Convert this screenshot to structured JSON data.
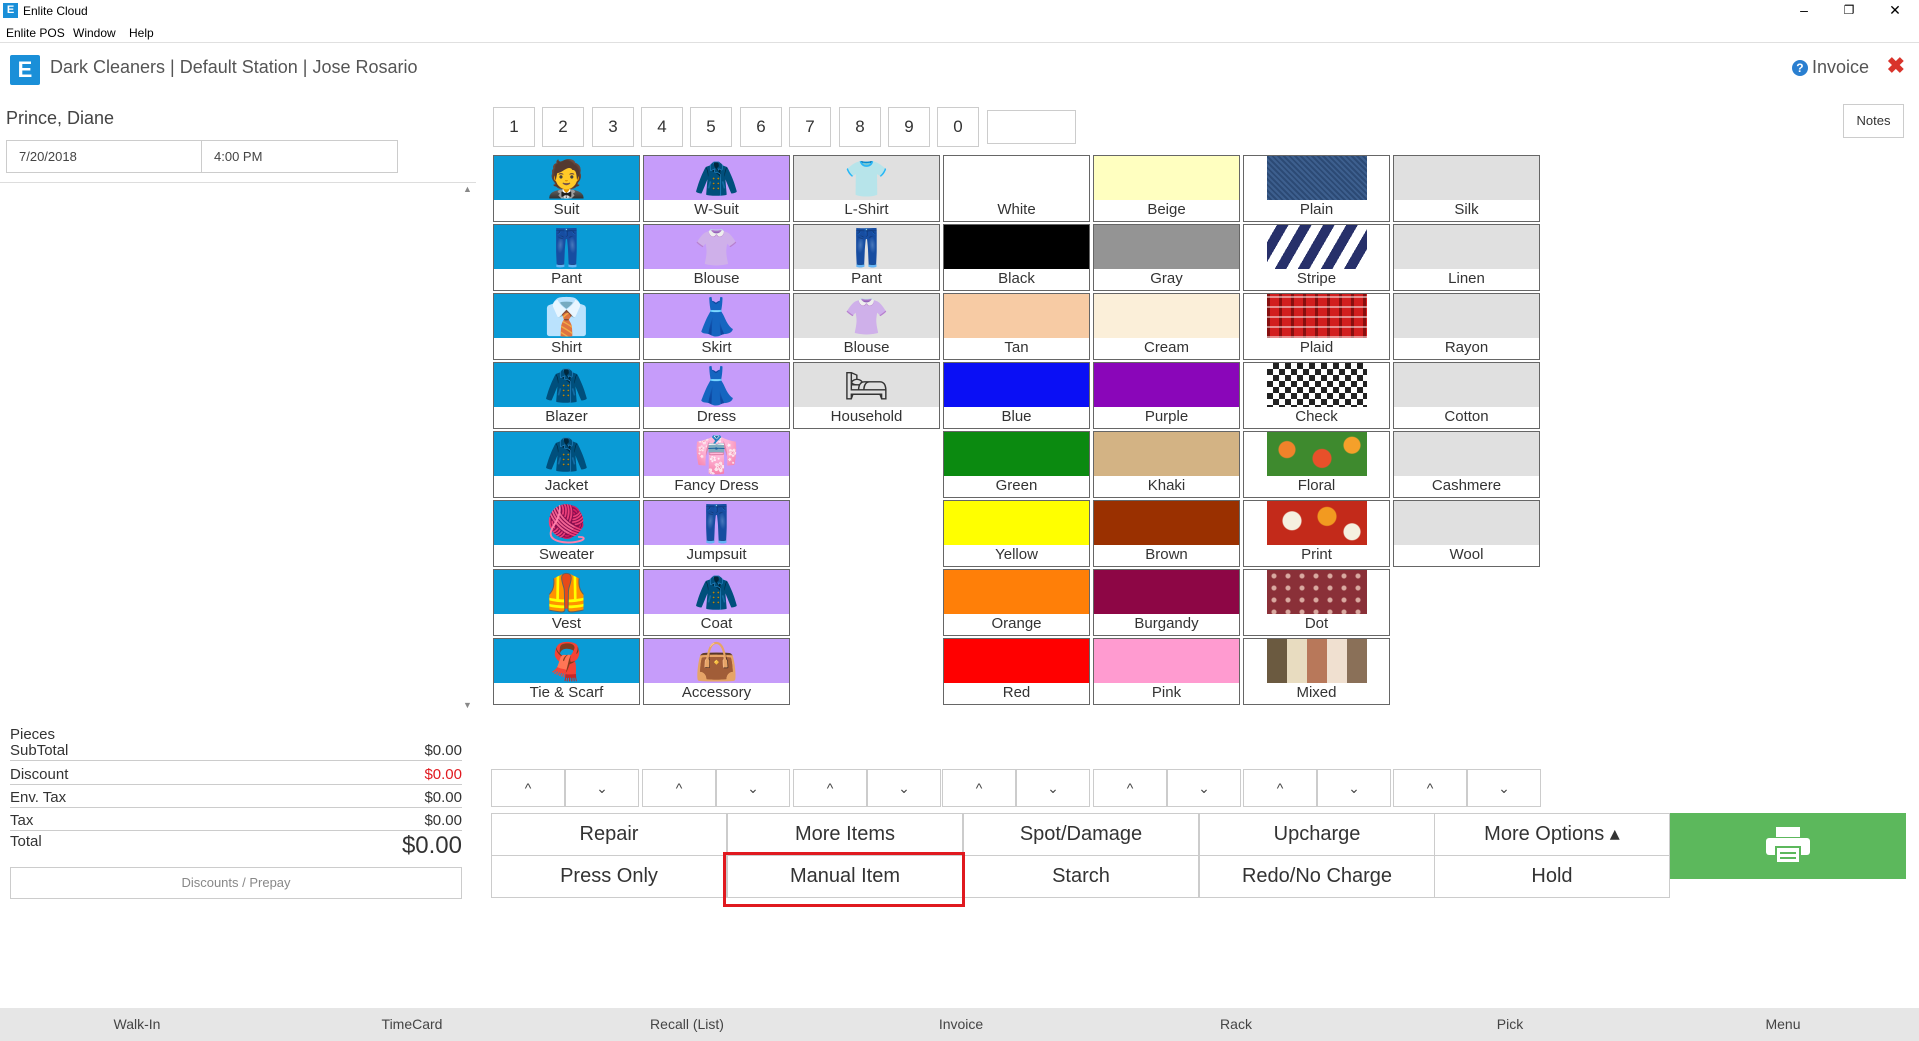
{
  "window": {
    "title": "Enlite Cloud",
    "logo_letter": "E",
    "minimize": "–",
    "restore": "❐",
    "close": "✕"
  },
  "menu": [
    "Enlite POS",
    "Window",
    "Help"
  ],
  "header": {
    "title": "Dark Cleaners | Default Station | Jose Rosario",
    "invoice_label": "Invoice",
    "help_glyph": "?",
    "close_glyph": "✖"
  },
  "customer": {
    "name": "Prince, Diane",
    "date": "7/20/2018",
    "time": "4:00 PM"
  },
  "totals": {
    "pieces_label": "Pieces",
    "subtotal_label": "SubTotal",
    "subtotal": "$0.00",
    "discount_label": "Discount",
    "discount": "$0.00",
    "envtax_label": "Env. Tax",
    "envtax": "$0.00",
    "tax_label": "Tax",
    "tax": "$0.00",
    "total_label": "Total",
    "total": "$0.00",
    "discount_color": "#e0191f"
  },
  "discounts_button": "Discounts / Prepay",
  "keypad": [
    "1",
    "2",
    "3",
    "4",
    "5",
    "6",
    "7",
    "8",
    "9",
    "0"
  ],
  "notes_button": "Notes",
  "garments_col1": [
    "Suit",
    "Pant",
    "Shirt",
    "Blazer",
    "Jacket",
    "Sweater",
    "Vest",
    "Tie & Scarf"
  ],
  "garments_col2": [
    "W-Suit",
    "Blouse",
    "Skirt",
    "Dress",
    "Fancy Dress",
    "Jumpsuit",
    "Coat",
    "Accessory"
  ],
  "garments_col3": [
    "L-Shirt",
    "Pant",
    "Blouse",
    "Household"
  ],
  "colors": [
    {
      "label": "White",
      "hex": "#ffffff"
    },
    {
      "label": "Black",
      "hex": "#000000"
    },
    {
      "label": "Tan",
      "hex": "#f7cba4"
    },
    {
      "label": "Blue",
      "hex": "#0a0ff5"
    },
    {
      "label": "Green",
      "hex": "#0b8a10"
    },
    {
      "label": "Yellow",
      "hex": "#ffff00"
    },
    {
      "label": "Orange",
      "hex": "#ff7f08"
    },
    {
      "label": "Red",
      "hex": "#ff0000"
    }
  ],
  "colors2": [
    {
      "label": "Beige",
      "hex": "#ffffc0"
    },
    {
      "label": "Gray",
      "hex": "#949494"
    },
    {
      "label": "Cream",
      "hex": "#fbefd9"
    },
    {
      "label": "Purple",
      "hex": "#8a06b9"
    },
    {
      "label": "Khaki",
      "hex": "#d3b384"
    },
    {
      "label": "Brown",
      "hex": "#9a3000"
    },
    {
      "label": "Burgandy",
      "hex": "#8d0645"
    },
    {
      "label": "Pink",
      "hex": "#ff9bd0"
    }
  ],
  "patterns": [
    "Plain",
    "Stripe",
    "Plaid",
    "Check",
    "Floral",
    "Print",
    "Dot",
    "Mixed"
  ],
  "fabrics": [
    "Silk",
    "Linen",
    "Rayon",
    "Cotton",
    "Cashmere",
    "Wool"
  ],
  "tile_colors": {
    "col1": "#0a9bd6",
    "col2": "#c69cfa",
    "col3": "#e0e0e0",
    "fabric": "#e0e0e0"
  },
  "arrows": {
    "up": "^",
    "down": "⌄"
  },
  "actions_row1": [
    "Repair",
    "More Items",
    "Spot/Damage",
    "Upcharge",
    "More Options ▴"
  ],
  "actions_row2": [
    "Press Only",
    "Manual Item",
    "Starch",
    "Redo/No Charge",
    "Hold"
  ],
  "print_color": "#5cb85c",
  "highlight_color": "#e0191f",
  "footer": [
    "Walk-In",
    "TimeCard",
    "Recall (List)",
    "Invoice",
    "Rack",
    "Pick",
    "Menu"
  ]
}
